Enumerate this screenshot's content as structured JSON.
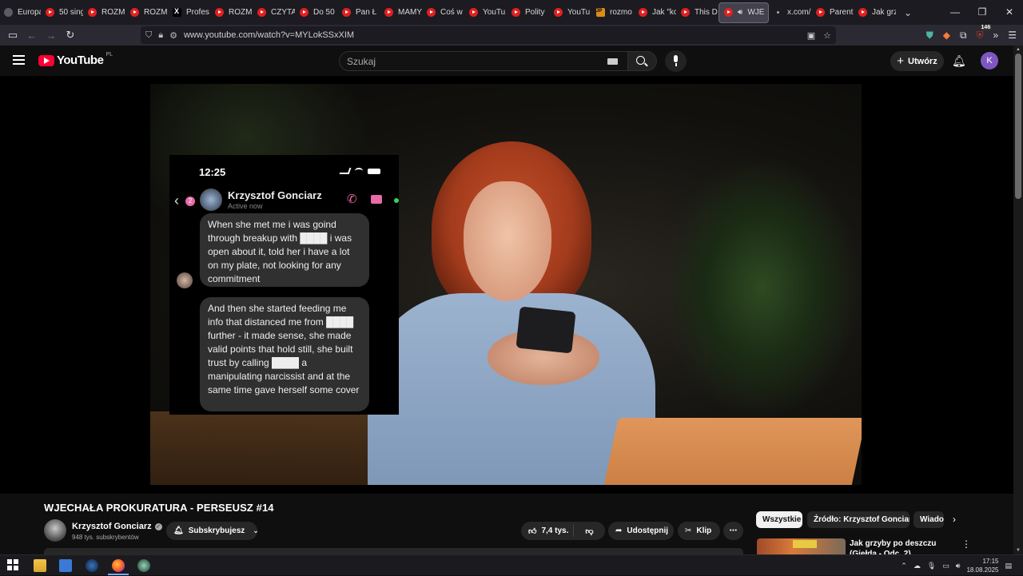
{
  "browser": {
    "tabs": [
      {
        "label": "Europa",
        "icon": "globe-icon",
        "kind": "globe"
      },
      {
        "label": "50 sing",
        "icon": "youtube-icon",
        "kind": "yt"
      },
      {
        "label": "ROZM",
        "icon": "youtube-icon",
        "kind": "yt"
      },
      {
        "label": "ROZM",
        "icon": "youtube-icon",
        "kind": "yt"
      },
      {
        "label": "Profes",
        "icon": "x-icon",
        "kind": "x"
      },
      {
        "label": "ROZM",
        "icon": "youtube-icon",
        "kind": "yt"
      },
      {
        "label": "CZYTA",
        "icon": "youtube-icon",
        "kind": "yt"
      },
      {
        "label": "Do 50",
        "icon": "youtube-icon",
        "kind": "yt"
      },
      {
        "label": "Pan Ł",
        "icon": "youtube-icon",
        "kind": "yt"
      },
      {
        "label": "MAMY",
        "icon": "youtube-icon",
        "kind": "yt"
      },
      {
        "label": "Coś w",
        "icon": "youtube-icon",
        "kind": "yt"
      },
      {
        "label": "YouTu",
        "icon": "youtube-icon",
        "kind": "yt"
      },
      {
        "label": "Polity",
        "icon": "youtube-icon",
        "kind": "yt"
      },
      {
        "label": "YouTu",
        "icon": "youtube-icon",
        "kind": "yt"
      },
      {
        "label": "rozmo",
        "icon": "jp-icon",
        "kind": "jp"
      },
      {
        "label": "Jak \"ko",
        "icon": "youtube-icon",
        "kind": "yt"
      },
      {
        "label": "This D",
        "icon": "youtube-icon",
        "kind": "yt"
      },
      {
        "label": "WJE",
        "icon": "youtube-icon",
        "kind": "yt",
        "active": true
      },
      {
        "label": "x.com/",
        "icon": "dot-icon",
        "kind": "dot"
      },
      {
        "label": "Parent",
        "icon": "youtube-icon",
        "kind": "yt"
      },
      {
        "label": "Jak grz",
        "icon": "youtube-icon",
        "kind": "yt"
      }
    ],
    "url": "www.youtube.com/watch?v=MYLokSSxXIM",
    "extensions_badge": "146"
  },
  "youtube": {
    "logo_text": "YouTube",
    "region": "PL",
    "search_placeholder": "Szukaj",
    "create_label": "Utwórz",
    "avatar_letter": "K"
  },
  "chat_overlay": {
    "time": "12:25",
    "contact_name": "Krzysztof Gonciarz",
    "contact_status": "Active now",
    "unread_count": "2",
    "messages": [
      "When she met me i was goind through breakup with ████ i was open about it, told her i have a lot on my plate, not looking for any commitment",
      "And then she started feeding me info that distanced me from ████ further - it made sense, she made valid points that hold still, she built trust by calling ████ a manipulating narcissist and at the same time gave herself some cover"
    ]
  },
  "video": {
    "title": "WJECHAŁA PROKURATURA - PERSEUSZ #14",
    "channel_name": "Krzysztof Gonciarz",
    "subscribers": "948 tys. subskrybentów",
    "subscribe_label": "Subskrybujesz",
    "likes": "7,4 tys.",
    "share_label": "Udostępnij",
    "clip_label": "Klip"
  },
  "sidebar": {
    "chips": [
      "Wszystkie",
      "Źródło: Krzysztof Gonciarz",
      "Wiadomości"
    ],
    "recommendation_title": "Jak grzyby po deszczu (Giełda - Odc. 2)"
  },
  "taskbar": {
    "time": "17:15",
    "date": "18.08.2025"
  }
}
